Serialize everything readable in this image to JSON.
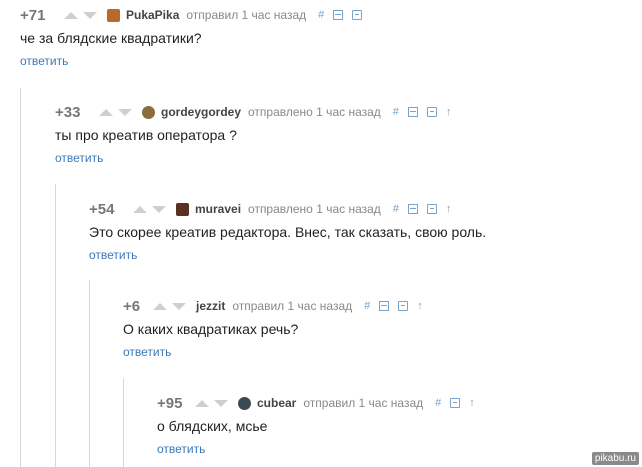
{
  "comments": [
    {
      "score": "+71",
      "user": "PukaPika",
      "meta": "отправил 1 час назад",
      "text": "че за блядские квадратики?",
      "reply": "ответить",
      "avatar_color": "#b86a2a",
      "has_up": false
    },
    {
      "score": "+33",
      "user": "gordeygordey",
      "meta": "отправлено 1 час назад",
      "text": "ты про креатив оператора ?",
      "reply": "ответить",
      "avatar_color": "#8a6d3b",
      "has_up": true
    },
    {
      "score": "+54",
      "user": "muravei",
      "meta": "отправлено 1 час назад",
      "text": "Это скорее креатив редактора. Внес, так сказать, свою роль.",
      "reply": "ответить",
      "avatar_color": "#5a3020",
      "has_up": true
    },
    {
      "score": "+6",
      "user": "jezzit",
      "meta": "отправил 1 час назад",
      "text": "О каких квадратиках речь?",
      "reply": "ответить",
      "avatar_color": "",
      "has_up": true
    },
    {
      "score": "+95",
      "user": "cubear",
      "meta": "отправил 1 час назад",
      "text": "о блядских, мсье",
      "reply": "ответить",
      "avatar_color": "#3a4a55",
      "has_up": true
    }
  ],
  "toolbar": {
    "link_symbol": "#",
    "up_symbol": "↑"
  },
  "watermark": "pikabu.ru"
}
